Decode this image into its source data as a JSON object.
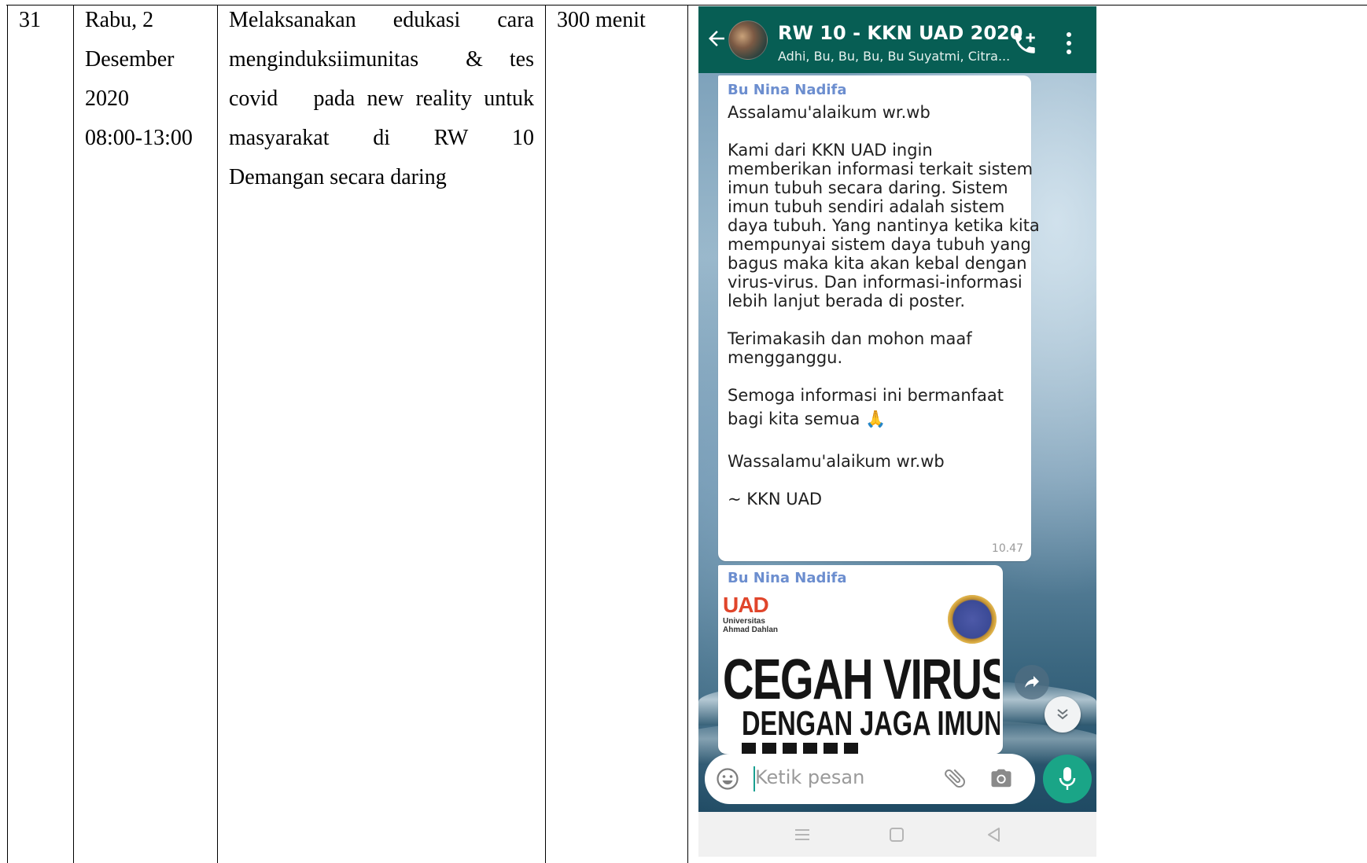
{
  "table": {
    "no": "31",
    "date_lines": [
      "Rabu, 2",
      "Desember",
      "2020",
      "08:00-13:00"
    ],
    "activity_lines": [
      [
        "Melaksanakan",
        "edukasi",
        "cara"
      ],
      [
        "menginduksi",
        "imunitas",
        "&",
        "tes"
      ],
      [
        "covid",
        "pada",
        "new",
        "reality",
        "untuk"
      ],
      [
        "masyarakat",
        "di",
        "RW",
        "10"
      ],
      [
        "Demangan secara daring"
      ]
    ],
    "duration": "300 menit"
  },
  "chat": {
    "group_title": "RW 10 - KKN UAD 2020",
    "group_members": "Adhi, Bu, Bu, Bu, Bu Suyatmi, Citra...",
    "message1": {
      "sender": "Bu Nina Nadifa",
      "lines": [
        "Assalamu'alaikum wr.wb",
        "",
        "Kami dari KKN UAD ingin",
        "memberikan informasi terkait sistem",
        "imun tubuh secara daring. Sistem",
        "imun tubuh sendiri adalah sistem",
        "daya tubuh. Yang nantinya ketika kita",
        "mempunyai sistem daya tubuh yang",
        "bagus maka kita akan kebal dengan",
        "virus-virus. Dan informasi-informasi",
        "lebih lanjut berada di poster.",
        "",
        "Terimakasih dan mohon maaf",
        "mengganggu.",
        "",
        "Semoga informasi ini bermanfaat",
        "bagi kita semua 🙏",
        "",
        "Wassalamu'alaikum wr.wb",
        "",
        "~ KKN UAD"
      ],
      "time": "10.47"
    },
    "message2": {
      "sender": "Bu Nina Nadifa",
      "poster": {
        "logo": "UAD",
        "logo_sub1": "Universitas",
        "logo_sub2": "Ahmad Dahlan",
        "title": "CEGAH VIRUS",
        "subtitle": "DENGAN JAGA IMUN"
      }
    },
    "input_placeholder": "Ketik pesan"
  },
  "icons": {
    "back": "arrow-left-icon",
    "call": "add-call-icon",
    "menu": "more-vert-icon",
    "emoji": "emoji-icon",
    "attach": "paperclip-icon",
    "camera": "camera-icon",
    "mic": "microphone-icon",
    "share": "share-icon",
    "scroll_down": "double-chevron-down-icon",
    "nav_menu": "nav-menu-icon",
    "nav_home": "nav-home-icon",
    "nav_back": "nav-back-icon"
  },
  "colors": {
    "appbar": "#075e54",
    "sender_name": "#6c8ecf",
    "mic_button": "#1aa587"
  }
}
